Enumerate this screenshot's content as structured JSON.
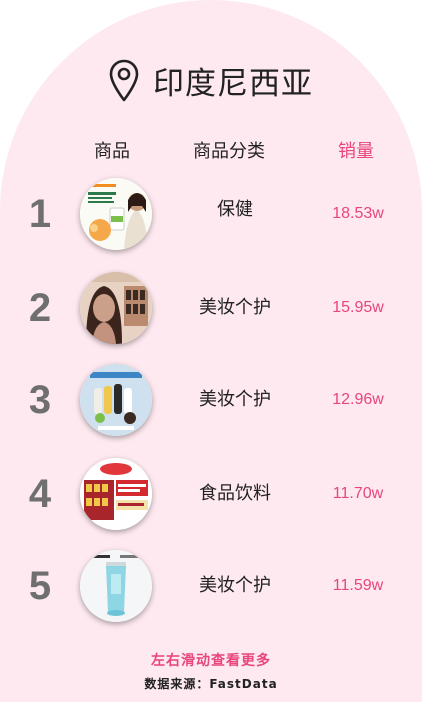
{
  "title": "印度尼西亚",
  "headers": {
    "product": "商品",
    "category": "商品分类",
    "sales": "销量"
  },
  "rows": [
    {
      "rank": "1",
      "category": "保健",
      "sales": "18.53w"
    },
    {
      "rank": "2",
      "category": "美妆个护",
      "sales": "15.95w"
    },
    {
      "rank": "3",
      "category": "美妆个护",
      "sales": "12.96w"
    },
    {
      "rank": "4",
      "category": "食品饮料",
      "sales": "11.70w"
    },
    {
      "rank": "5",
      "category": "美妆个护",
      "sales": "11.59w"
    }
  ],
  "footer": {
    "hint": "左右滑动查看更多",
    "source": "数据来源：FastData"
  },
  "colors": {
    "background": "#fde9ef",
    "accent": "#e8467c",
    "rank": "#6f6f6f"
  },
  "icons": {
    "title": "location-pin-icon"
  }
}
